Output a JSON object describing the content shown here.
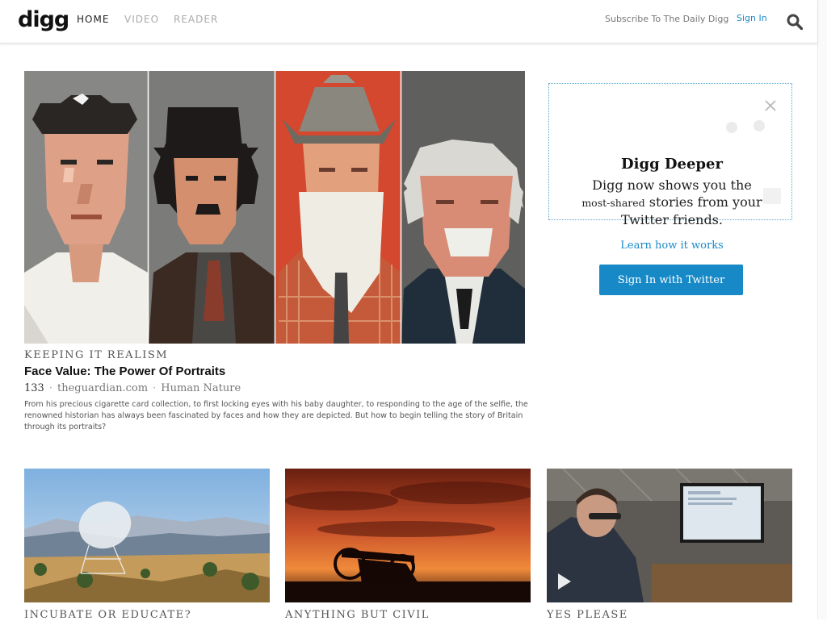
{
  "header": {
    "logo": "digg",
    "nav": [
      {
        "label": "HOME",
        "active": true
      },
      {
        "label": "VIDEO",
        "active": false
      },
      {
        "label": "READER",
        "active": false
      }
    ],
    "subscribe": "Subscribe To The Daily Digg",
    "signin": "Sign In",
    "search_icon": "search-icon"
  },
  "hero": {
    "kicker": "KEEPING IT REALISM",
    "title": "Face Value: The Power Of Portraits",
    "count": "133",
    "source": "theguardian.com",
    "category": "Human Nature",
    "description": "From his precious cigarette card collection, to first locking eyes with his baby daughter, to responding to the age of the selfie, the renowned historian has always been fascinated by faces and how they are depicted. But how to begin telling the story of Britain through its portraits?"
  },
  "promo": {
    "title": "Digg Deeper",
    "text_line1": "Digg now shows you the",
    "text_small": "most-shared",
    "text_line2_rest": "stories from your",
    "text_line3": "Twitter friends.",
    "learn_link": "Learn how it works",
    "button": "Sign In with Twitter",
    "close_icon": "close-icon"
  },
  "cards": [
    {
      "kicker": "INCUBATE OR EDUCATE?"
    },
    {
      "kicker": "ANYTHING BUT CIVIL"
    },
    {
      "kicker": "YES PLEASE"
    }
  ],
  "colors": {
    "accent": "#1789c7",
    "link": "#1b8ac8"
  }
}
